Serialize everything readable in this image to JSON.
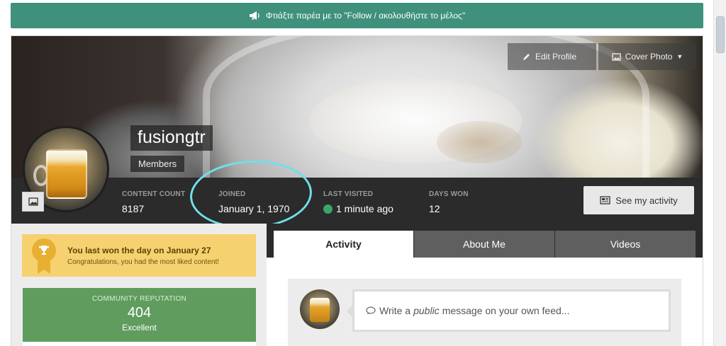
{
  "announcement": {
    "icon": "megaphone-icon",
    "text": "Φτιάξτε παρέα με το \"Follow / ακολουθήστε το μέλος\""
  },
  "cover": {
    "edit_profile_label": "Edit Profile",
    "cover_photo_label": "Cover Photo"
  },
  "profile": {
    "username": "fusiongtr",
    "group": "Members"
  },
  "stats": {
    "content_count_label": "CONTENT COUNT",
    "content_count_value": "8187",
    "joined_label": "JOINED",
    "joined_value": "January 1, 1970",
    "last_visited_label": "LAST VISITED",
    "last_visited_value": "1 minute ago",
    "days_won_label": "DAYS WON",
    "days_won_value": "12"
  },
  "activity_button_label": "See my activity",
  "badge": {
    "title": "You last won the day on January 27",
    "subtitle": "Congratulations, you had the most liked content!"
  },
  "reputation": {
    "label": "COMMUNITY REPUTATION",
    "value": "404",
    "word": "Excellent"
  },
  "tabs": [
    {
      "label": "Activity",
      "active": true
    },
    {
      "label": "About Me",
      "active": false
    },
    {
      "label": "Videos",
      "active": false
    }
  ],
  "composer": {
    "text_before": "Write a",
    "text_emph": "public",
    "text_after": "message on your own feed..."
  },
  "colors": {
    "announcement_bg": "#3f917b",
    "stats_bg": "#2b2b2b",
    "badge_bg": "#f6d16f",
    "reputation_bg": "#5f9c5d",
    "online": "#3aa56c",
    "annotation": "#6fe0ea"
  }
}
